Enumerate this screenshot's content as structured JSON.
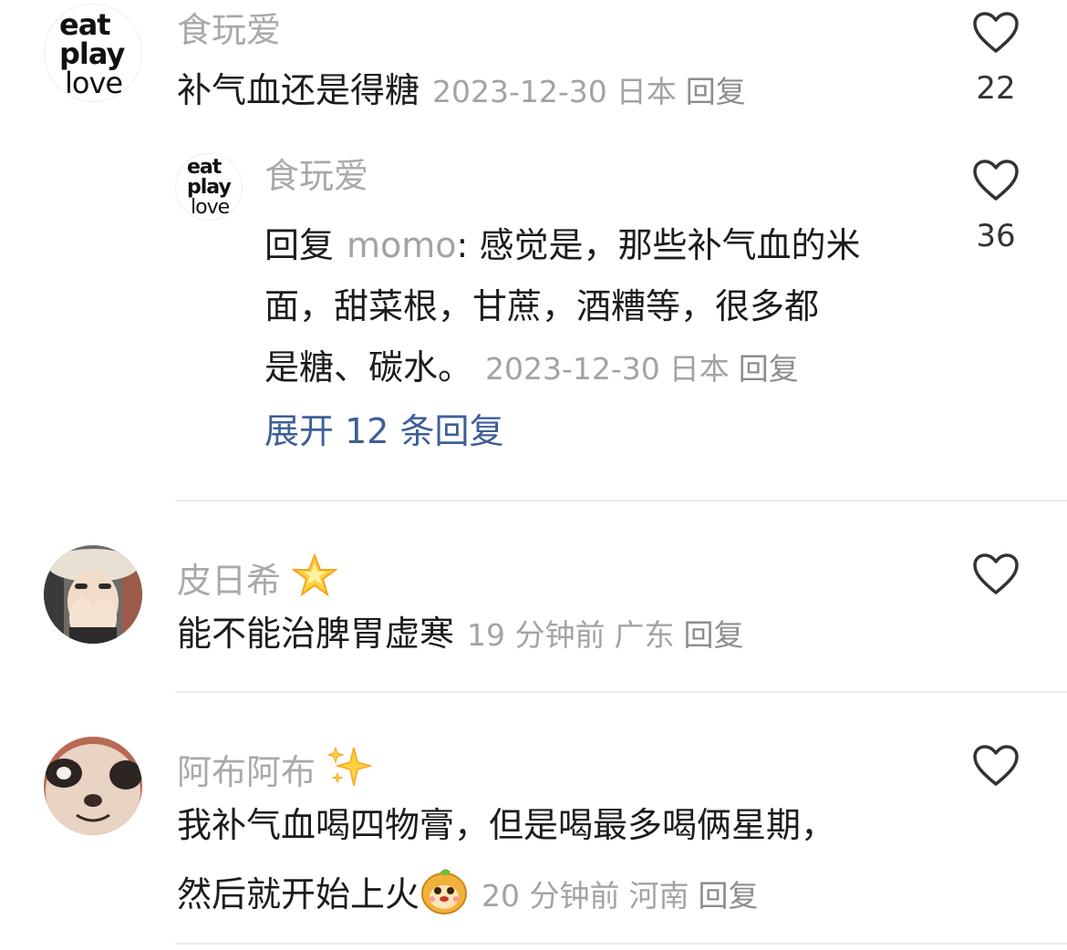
{
  "comments": [
    {
      "username": "食玩爱",
      "avatar_text": [
        "eat",
        "play",
        "love"
      ],
      "text": "补气血还是得糖",
      "time": "2023-12-30",
      "location": "日本",
      "reply_label": "回复",
      "likes": "22",
      "icon": "heart-outline-icon",
      "replies": [
        {
          "username": "食玩爱",
          "avatar_text": [
            "eat",
            "play",
            "love"
          ],
          "prefix": "回复",
          "mention": "momo",
          "text_line1": "感觉是，那些补气血的米",
          "text_line2": "面，甜菜根，甘蔗，酒糟等，很多都",
          "text_line3": "是糖、碳水。",
          "time": "2023-12-30",
          "location": "日本",
          "reply_label": "回复",
          "likes": "36"
        }
      ],
      "expand_label": "展开 12 条回复"
    },
    {
      "username": "皮日希",
      "username_emoji": "star-emoji",
      "text": "能不能治脾胃虚寒",
      "time": "19 分钟前",
      "location": "广东",
      "reply_label": "回复"
    },
    {
      "username": "阿布阿布",
      "username_emoji": "sparkles-emoji",
      "text_line1": "我补气血喝四物膏，但是喝最多喝俩星期，",
      "text_line2": "然后就开始上火",
      "text_emoji": "monkey-face-emoji",
      "time": "20 分钟前",
      "location": "河南",
      "reply_label": "回复"
    }
  ],
  "colors": {
    "username": "#a9a9a9",
    "meta": "#a3a3a3",
    "expand_link": "#3e5f97",
    "divider": "#ececec",
    "heart_stroke": "#333333"
  }
}
